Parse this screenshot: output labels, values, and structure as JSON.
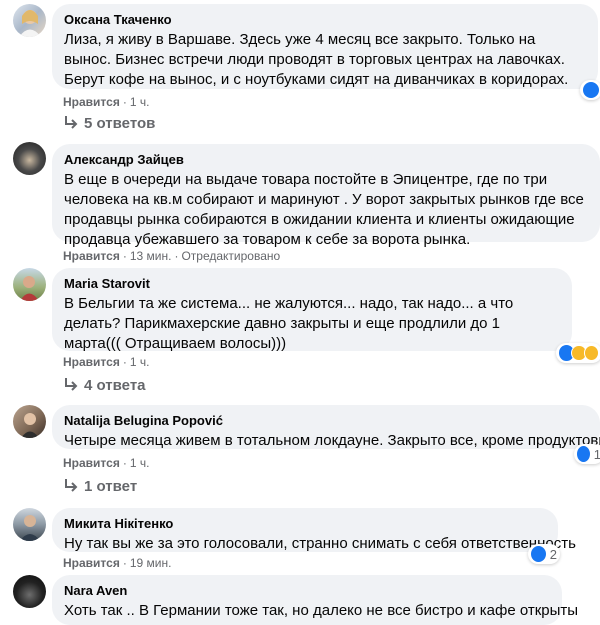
{
  "comments": [
    {
      "author": "Оксана Ткаченко",
      "text": "Лиза, я живу в Варшаве. Здесь уже 4 месяц все закрыто. Только на вынос. Бизнес встречи люди проводят в торговых центрах на лавочках. Берут кофе на вынос, и с ноутбуками сидят на диванчиках в коридорах.",
      "like_label": "Нравится",
      "time": "1 ч.",
      "edited": "",
      "replies": "5 ответов",
      "reaction_count": ""
    },
    {
      "author": "Александр Зайцев",
      "text": "В еще в очереди на выдаче товара постойте в Эпицентре, где по три человека на кв.м собирают и маринуют . У ворот закрытых рынков где все продавцы рынка собираются в ожидании клиента и клиенты ожидающие продавца убежавшего за товаром к себе за ворота рынка.",
      "like_label": "Нравится",
      "time": "13 мин.",
      "edited": "Отредактировано",
      "replies": "",
      "reaction_count": ""
    },
    {
      "author": "Maria Starovit",
      "text": "В Бельгии та же система... не жалуются... надо, так надо... а что делать? Парикмахерские давно закрыты и еще продлили до 1 марта((( Отращиваем волосы)))",
      "like_label": "Нравится",
      "time": "1 ч.",
      "edited": "",
      "replies": "4 ответа",
      "reaction_count": ""
    },
    {
      "author": "Natalija Belugina Popović",
      "text": "Четыре месяца живем в тотальном локдауне. Закрыто все, кроме продуктовых.",
      "like_label": "Нравится",
      "time": "1 ч.",
      "edited": "",
      "replies": "1 ответ",
      "reaction_count": "1"
    },
    {
      "author": "Микита Нікітенко",
      "text": "Ну так вы же за это голосовали, странно снимать с себя ответственность",
      "like_label": "Нравится",
      "time": "19 мин.",
      "edited": "",
      "replies": "",
      "reaction_count": "2"
    },
    {
      "author": "Nara Aven",
      "text": "Хоть так .. В Германии тоже так, но далеко не все бистро и кафе открыты",
      "like_label": "",
      "time": "",
      "edited": "",
      "replies": "",
      "reaction_count": ""
    }
  ],
  "colors": {
    "bubble_bg": "#f0f2f5",
    "meta_text": "#65676b",
    "like_blue": "#1877f2",
    "reaction_yellow": "#f7b928"
  }
}
